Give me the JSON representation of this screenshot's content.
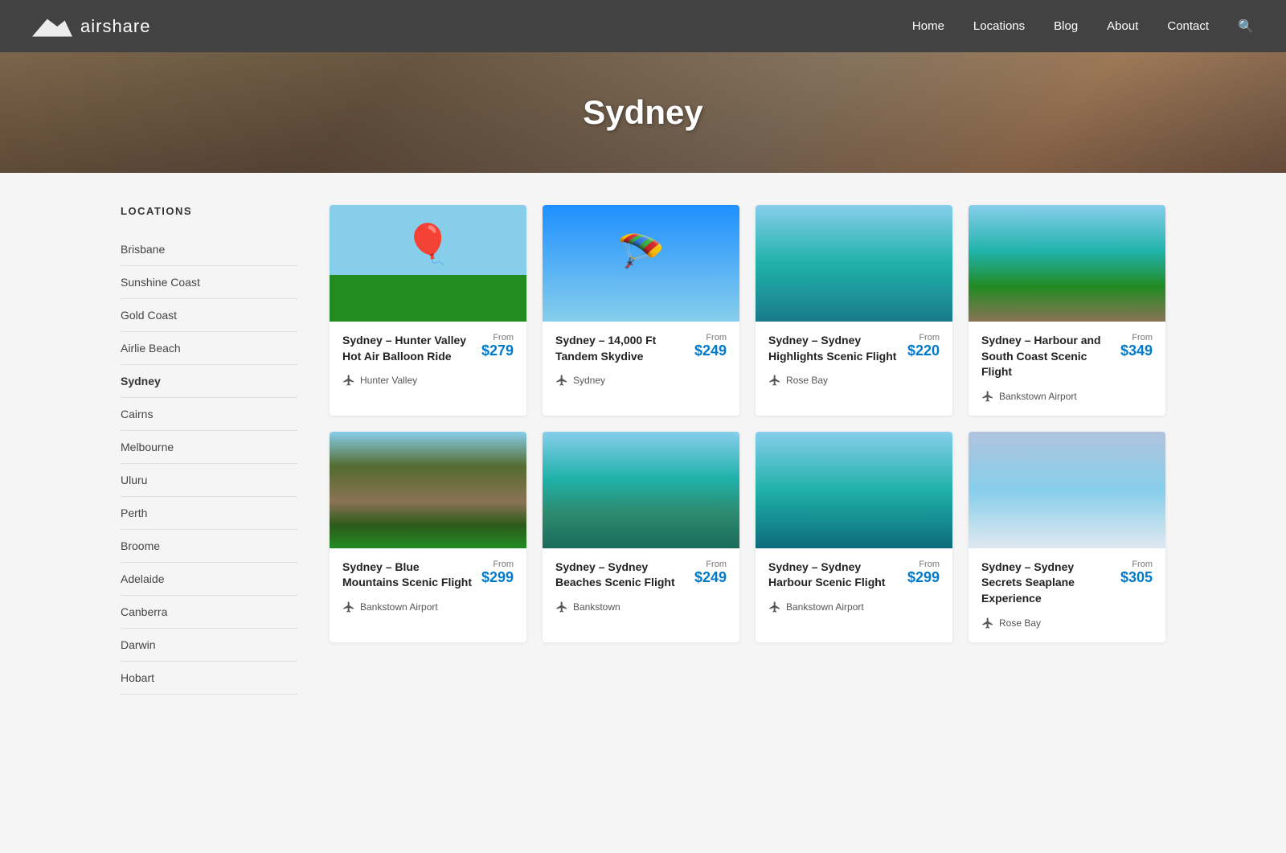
{
  "nav": {
    "brand": "airshare",
    "links": [
      {
        "label": "Home",
        "href": "#"
      },
      {
        "label": "Locations",
        "href": "#"
      },
      {
        "label": "Blog",
        "href": "#"
      },
      {
        "label": "About",
        "href": "#"
      },
      {
        "label": "Contact",
        "href": "#"
      }
    ]
  },
  "hero": {
    "title": "Sydney"
  },
  "sidebar": {
    "section_title": "LOCATIONS",
    "items": [
      {
        "label": "Brisbane"
      },
      {
        "label": "Sunshine Coast"
      },
      {
        "label": "Gold Coast"
      },
      {
        "label": "Airlie Beach"
      },
      {
        "label": "Sydney",
        "active": true
      },
      {
        "label": "Cairns"
      },
      {
        "label": "Melbourne"
      },
      {
        "label": "Uluru"
      },
      {
        "label": "Perth"
      },
      {
        "label": "Broome"
      },
      {
        "label": "Adelaide"
      },
      {
        "label": "Canberra"
      },
      {
        "label": "Darwin"
      },
      {
        "label": "Hobart"
      }
    ]
  },
  "cards_row1": [
    {
      "title": "Sydney – Hunter Valley Hot Air Balloon Ride",
      "from_label": "From",
      "price": "$279",
      "location": "Hunter Valley",
      "img_class": "img-balloon"
    },
    {
      "title": "Sydney – 14,000 Ft Tandem Skydive",
      "from_label": "From",
      "price": "$249",
      "location": "Sydney",
      "img_class": "img-skydive"
    },
    {
      "title": "Sydney – Sydney Highlights Scenic Flight",
      "from_label": "From",
      "price": "$220",
      "location": "Rose Bay",
      "img_class": "img-sydney-harbour"
    },
    {
      "title": "Sydney – Harbour and South Coast Scenic Flight",
      "from_label": "From",
      "price": "$349",
      "location": "Bankstown Airport",
      "img_class": "img-aerial-coast"
    }
  ],
  "cards_row2": [
    {
      "title": "Sydney – Blue Mountains Scenic Flight",
      "from_label": "From",
      "price": "$299",
      "location": "Bankstown Airport",
      "img_class": "img-mountains"
    },
    {
      "title": "Sydney – Sydney Beaches Scenic Flight",
      "from_label": "From",
      "price": "$249",
      "location": "Bankstown",
      "img_class": "img-beaches"
    },
    {
      "title": "Sydney – Sydney Harbour Scenic Flight",
      "from_label": "From",
      "price": "$299",
      "location": "Bankstown Airport",
      "img_class": "img-harbour-bridge"
    },
    {
      "title": "Sydney – Sydney Secrets Seaplane Experience",
      "from_label": "From",
      "price": "$305",
      "location": "Rose Bay",
      "img_class": "img-seaplane"
    }
  ]
}
